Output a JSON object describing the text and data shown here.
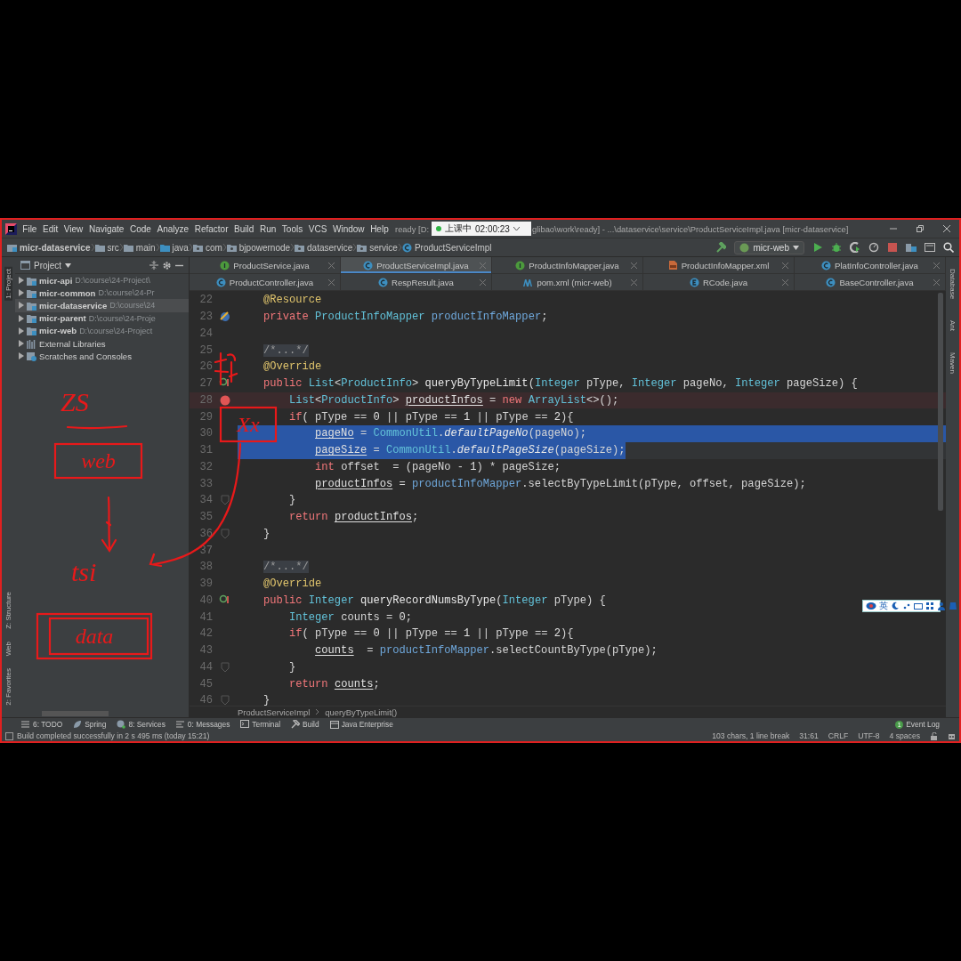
{
  "title_bar": {
    "menu": [
      "File",
      "Edit",
      "View",
      "Navigate",
      "Code",
      "Analyze",
      "Refactor",
      "Build",
      "Run",
      "Tools",
      "VCS",
      "Window",
      "Help"
    ],
    "title_left": "ready [D:",
    "title_right": "glibao\\work\\ready] - ...\\dataservice\\service\\ProductServiceImpl.java [micr-dataservice]"
  },
  "recorder": {
    "status": "上课中",
    "time": "02:00:23"
  },
  "nav_bar": {
    "breadcrumb": [
      {
        "label": "micr-dataservice",
        "kind": "module"
      },
      {
        "label": "src",
        "kind": "folder"
      },
      {
        "label": "main",
        "kind": "folder"
      },
      {
        "label": "java",
        "kind": "source"
      },
      {
        "label": "com",
        "kind": "package"
      },
      {
        "label": "bjpowernode",
        "kind": "package"
      },
      {
        "label": "dataservice",
        "kind": "package"
      },
      {
        "label": "service",
        "kind": "package"
      },
      {
        "label": "ProductServiceImpl",
        "kind": "class"
      }
    ],
    "run_config": "micr-web"
  },
  "left_strip": [
    {
      "label": "1: Project",
      "selected": true
    },
    {
      "label": "Z: Structure",
      "selected": false
    },
    {
      "label": "Web",
      "selected": false
    },
    {
      "label": "2: Favorites",
      "selected": false
    }
  ],
  "right_strip": [
    {
      "label": "Database",
      "selected": false
    },
    {
      "label": "Ant",
      "selected": false
    },
    {
      "label": "Maven",
      "selected": false
    }
  ],
  "project_panel": {
    "title": "Project",
    "items": [
      {
        "name": "micr-api",
        "path": "D:\\course\\24-Project\\",
        "kind": "module",
        "selected": false
      },
      {
        "name": "micr-common",
        "path": "D:\\course\\24-Pr",
        "kind": "module",
        "selected": false
      },
      {
        "name": "micr-dataservice",
        "path": "D:\\course\\24",
        "kind": "module",
        "selected": true
      },
      {
        "name": "micr-parent",
        "path": "D:\\course\\24-Proje",
        "kind": "module",
        "selected": false
      },
      {
        "name": "micr-web",
        "path": "D:\\course\\24-Project",
        "kind": "module",
        "selected": false
      },
      {
        "name": "External Libraries",
        "kind": "libraries",
        "selected": false
      },
      {
        "name": "Scratches and Consoles",
        "kind": "scratches",
        "selected": false
      }
    ]
  },
  "tab_rows": [
    {
      "tabs": [
        {
          "label": "ProductService.java",
          "kind": "interface",
          "selected": false
        },
        {
          "label": "ProductServiceImpl.java",
          "kind": "class",
          "selected": true
        },
        {
          "label": "ProductInfoMapper.java",
          "kind": "interface",
          "selected": false
        },
        {
          "label": "ProductInfoMapper.xml",
          "kind": "xml",
          "selected": false
        },
        {
          "label": "PlatInfoController.java",
          "kind": "class",
          "selected": false
        }
      ]
    },
    {
      "tabs": [
        {
          "label": "ProductController.java",
          "kind": "class",
          "selected": false
        },
        {
          "label": "RespResult.java",
          "kind": "class",
          "selected": false
        },
        {
          "label": "pom.xml (micr-web)",
          "kind": "maven",
          "selected": false
        },
        {
          "label": "RCode.java",
          "kind": "enum",
          "selected": false
        },
        {
          "label": "BaseController.java",
          "kind": "class",
          "selected": false
        }
      ]
    }
  ],
  "code_lines": [
    {
      "number": "22",
      "kind": "plain",
      "tokens": [
        {
          "text": "    @Resource",
          "kind": "annotation"
        }
      ]
    },
    {
      "number": "23",
      "kind": "plain",
      "marker": {
        "kind": "bean"
      },
      "tokens": [
        {
          "text": "    private",
          "kind": "keyword"
        },
        {
          "text": " ProductInfoMapper",
          "kind": "type"
        },
        {
          "text": " productInfoMapper",
          "kind": "field"
        },
        {
          "text": ";",
          "kind": "plain"
        }
      ]
    },
    {
      "number": "24",
      "kind": "plain"
    },
    {
      "number": "25",
      "kind": "plain",
      "tokens": [
        {
          "text": "    /*...*/",
          "kind": "comment"
        }
      ]
    },
    {
      "number": "26",
      "kind": "plain",
      "tokens": [
        {
          "text": "    @Override",
          "kind": "annotation"
        }
      ]
    },
    {
      "number": "27",
      "kind": "plain",
      "marker": {
        "kind": "override"
      },
      "tokens": [
        {
          "text": "    public",
          "kind": "keyword"
        },
        {
          "text": " List",
          "kind": "type"
        },
        {
          "text": "<",
          "kind": "plain"
        },
        {
          "text": "ProductInfo",
          "kind": "type"
        },
        {
          "text": "> ",
          "kind": "plain"
        },
        {
          "text": "queryByTypeLimit",
          "kind": "method"
        },
        {
          "text": "(",
          "kind": "plain"
        },
        {
          "text": "Integer",
          "kind": "type"
        },
        {
          "text": " pType, ",
          "kind": "plain"
        },
        {
          "text": "Integer",
          "kind": "type"
        },
        {
          "text": " pageNo, ",
          "kind": "plain"
        },
        {
          "text": "Integer",
          "kind": "type"
        },
        {
          "text": " pageSize) {",
          "kind": "plain"
        }
      ]
    },
    {
      "number": "28",
      "kind": "breakpoint",
      "marker": {
        "kind": "breakpoint"
      },
      "tokens": [
        {
          "text": "        List",
          "kind": "type"
        },
        {
          "text": "<",
          "kind": "plain"
        },
        {
          "text": "ProductInfo",
          "kind": "type"
        },
        {
          "text": "> ",
          "kind": "plain"
        },
        {
          "text": "productInfos",
          "kind": "variable"
        },
        {
          "text": " = ",
          "kind": "plain"
        },
        {
          "text": "new",
          "kind": "keyword"
        },
        {
          "text": " ArrayList",
          "kind": "type"
        },
        {
          "text": "<>();",
          "kind": "plain"
        }
      ]
    },
    {
      "number": "29",
      "kind": "plain",
      "tokens": [
        {
          "text": "        if",
          "kind": "keyword"
        },
        {
          "text": "( pType == ",
          "kind": "plain"
        },
        {
          "text": "0",
          "kind": "number"
        },
        {
          "text": " || pType == ",
          "kind": "plain"
        },
        {
          "text": "1",
          "kind": "number"
        },
        {
          "text": " || pType == ",
          "kind": "plain"
        },
        {
          "text": "2",
          "kind": "number"
        },
        {
          "text": "){",
          "kind": "plain"
        }
      ]
    },
    {
      "number": "30",
      "kind": "selection",
      "tokens": [
        {
          "text": "            pageNo",
          "kind": "variable"
        },
        {
          "text": " = ",
          "kind": "plain"
        },
        {
          "text": "CommonUtil",
          "kind": "type"
        },
        {
          "text": ".",
          "kind": "plain"
        },
        {
          "text": "defaultPageNo",
          "kind": "static"
        },
        {
          "text": "(pageNo);",
          "kind": "plain"
        }
      ]
    },
    {
      "number": "31",
      "kind": "selection-end",
      "tokens": [
        {
          "text": "            pageSize",
          "kind": "variable"
        },
        {
          "text": " = ",
          "kind": "plain"
        },
        {
          "text": "CommonUtil",
          "kind": "type"
        },
        {
          "text": ".",
          "kind": "plain"
        },
        {
          "text": "defaultPageSize",
          "kind": "static"
        },
        {
          "text": "(pageSize);",
          "kind": "plain"
        }
      ]
    },
    {
      "number": "32",
      "kind": "plain",
      "tokens": [
        {
          "text": "            int",
          "kind": "keyword"
        },
        {
          "text": " offset  = (pageNo - ",
          "kind": "plain"
        },
        {
          "text": "1",
          "kind": "number"
        },
        {
          "text": ") * pageSize;",
          "kind": "plain"
        }
      ]
    },
    {
      "number": "33",
      "kind": "plain",
      "tokens": [
        {
          "text": "            productInfos",
          "kind": "variable"
        },
        {
          "text": " = ",
          "kind": "plain"
        },
        {
          "text": "productInfoMapper",
          "kind": "field"
        },
        {
          "text": ".selectByTypeLimit(pType, offset, pageSize);",
          "kind": "plain"
        }
      ]
    },
    {
      "number": "34",
      "kind": "plain",
      "marker": {
        "kind": "fold"
      },
      "tokens": [
        {
          "text": "        }",
          "kind": "plain"
        }
      ]
    },
    {
      "number": "35",
      "kind": "plain",
      "tokens": [
        {
          "text": "        return",
          "kind": "keyword"
        },
        {
          "text": " productInfos",
          "kind": "variable"
        },
        {
          "text": ";",
          "kind": "plain"
        }
      ]
    },
    {
      "number": "36",
      "kind": "plain",
      "marker": {
        "kind": "fold"
      },
      "tokens": [
        {
          "text": "    }",
          "kind": "plain"
        }
      ]
    },
    {
      "number": "37",
      "kind": "plain"
    },
    {
      "number": "38",
      "kind": "plain",
      "tokens": [
        {
          "text": "    /*...*/",
          "kind": "comment"
        }
      ]
    },
    {
      "number": "39",
      "kind": "plain",
      "tokens": [
        {
          "text": "    @Override",
          "kind": "annotation"
        }
      ]
    },
    {
      "number": "40",
      "kind": "plain",
      "marker": {
        "kind": "override"
      },
      "tokens": [
        {
          "text": "    public",
          "kind": "keyword"
        },
        {
          "text": " Integer",
          "kind": "type"
        },
        {
          "text": " queryRecordNumsByType",
          "kind": "method"
        },
        {
          "text": "(",
          "kind": "plain"
        },
        {
          "text": "Integer",
          "kind": "type"
        },
        {
          "text": " pType) {",
          "kind": "plain"
        }
      ]
    },
    {
      "number": "41",
      "kind": "plain",
      "tokens": [
        {
          "text": "        Integer",
          "kind": "type"
        },
        {
          "text": " counts = ",
          "kind": "plain"
        },
        {
          "text": "0",
          "kind": "number"
        },
        {
          "text": ";",
          "kind": "plain"
        }
      ]
    },
    {
      "number": "42",
      "kind": "plain",
      "tokens": [
        {
          "text": "        if",
          "kind": "keyword"
        },
        {
          "text": "( pType == ",
          "kind": "plain"
        },
        {
          "text": "0",
          "kind": "number"
        },
        {
          "text": " || pType == ",
          "kind": "plain"
        },
        {
          "text": "1",
          "kind": "number"
        },
        {
          "text": " || pType == ",
          "kind": "plain"
        },
        {
          "text": "2",
          "kind": "number"
        },
        {
          "text": "){",
          "kind": "plain"
        }
      ]
    },
    {
      "number": "43",
      "kind": "plain",
      "tokens": [
        {
          "text": "            counts",
          "kind": "variable"
        },
        {
          "text": "  = ",
          "kind": "plain"
        },
        {
          "text": "productInfoMapper",
          "kind": "field"
        },
        {
          "text": ".selectCountByType(pType);",
          "kind": "plain"
        }
      ]
    },
    {
      "number": "44",
      "kind": "plain",
      "marker": {
        "kind": "fold"
      },
      "tokens": [
        {
          "text": "        }",
          "kind": "plain"
        }
      ]
    },
    {
      "number": "45",
      "kind": "plain",
      "tokens": [
        {
          "text": "        return",
          "kind": "keyword"
        },
        {
          "text": " counts",
          "kind": "variable"
        },
        {
          "text": ";",
          "kind": "plain"
        }
      ]
    },
    {
      "number": "46",
      "kind": "plain",
      "marker": {
        "kind": "fold"
      },
      "tokens": [
        {
          "text": "    }",
          "kind": "plain"
        }
      ]
    }
  ],
  "editor_breadcrumb": [
    "ProductServiceImpl",
    "queryByTypeLimit()"
  ],
  "ime": {
    "label": "英"
  },
  "tool_windows": [
    {
      "label": "6: TODO",
      "kind": "todo"
    },
    {
      "label": "Spring",
      "kind": "spring"
    },
    {
      "label": "8: Services",
      "kind": "services"
    },
    {
      "label": "0: Messages",
      "kind": "messages"
    },
    {
      "label": "Terminal",
      "kind": "terminal"
    },
    {
      "label": "Build",
      "kind": "build"
    },
    {
      "label": "Java Enterprise",
      "kind": "enterprise"
    }
  ],
  "event_log": {
    "badge": "1",
    "label": "Event Log"
  },
  "status_bar": {
    "message": "Build completed successfully in 2 s 495 ms (today 15:21)",
    "items": [
      "103 chars, 1 line break",
      "31:61",
      "CRLF",
      "UTF-8",
      "4 spaces"
    ]
  },
  "annotations": [
    {
      "kind": "note",
      "text": "ZS"
    },
    {
      "kind": "boxed",
      "text": "web"
    },
    {
      "kind": "note",
      "text": "tsi"
    },
    {
      "kind": "double-boxed",
      "text": "data"
    },
    {
      "kind": "boxed",
      "text": "Xx"
    }
  ]
}
